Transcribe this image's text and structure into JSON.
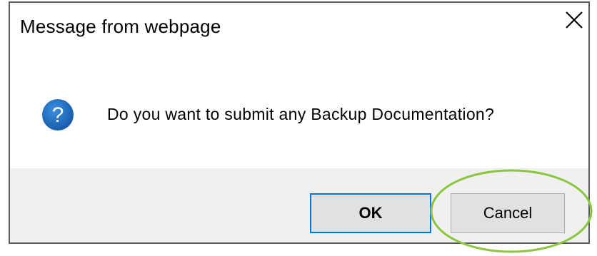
{
  "dialog": {
    "title": "Message from webpage",
    "close_glyph": "✕",
    "message": "Do you want to submit any Backup Documentation?",
    "icon": "question-icon",
    "icon_glyph": "?",
    "ok_label": "OK",
    "cancel_label": "Cancel"
  },
  "colors": {
    "icon_blue": "#1a6fc0",
    "default_button_border": "#0078d7",
    "footer_bg": "#f0f0f0",
    "annotation_green": "#8cc63f"
  },
  "annotation": {
    "type": "ellipse-highlight",
    "target": "cancel-button"
  }
}
